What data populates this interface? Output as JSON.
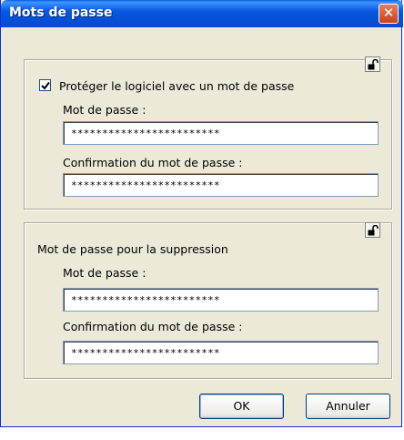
{
  "window": {
    "title": "Mots de passe",
    "close_glyph": "✕"
  },
  "software_group": {
    "checkbox_label": "Protéger le logiciel avec un mot de passe",
    "checked": true,
    "lock_icon": "unlocked-padlock-icon",
    "password_label": "Mot de passe :",
    "password_value": "************************",
    "confirm_label": "Confirmation du mot de passe :",
    "confirm_value": "************************"
  },
  "deletion_group": {
    "heading": "Mot de passe pour la suppression",
    "lock_icon": "unlocked-padlock-icon",
    "password_label": "Mot de passe :",
    "password_value": "************************",
    "confirm_label": "Confirmation du mot de passe :",
    "confirm_value": "************************"
  },
  "buttons": {
    "ok_label": "OK",
    "cancel_label": "Annuler"
  },
  "colors": {
    "titlebar": "#0a58e0",
    "close": "#c9411c",
    "dialog_bg": "#ece9d8"
  }
}
